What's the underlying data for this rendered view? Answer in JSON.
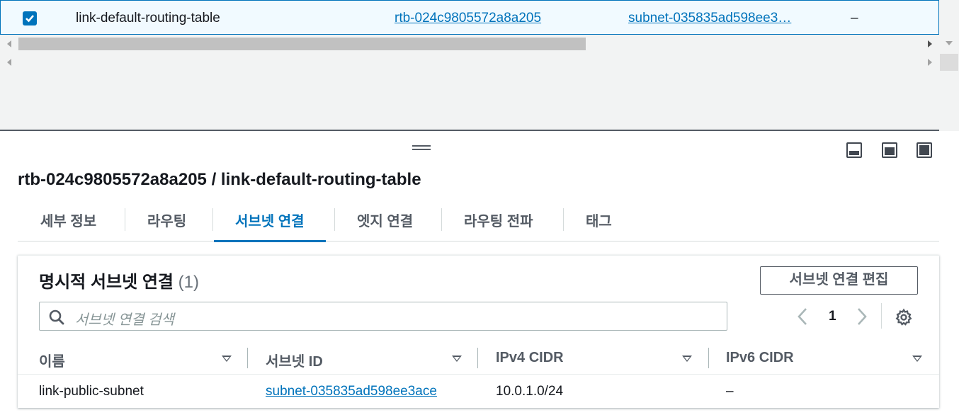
{
  "top_table": {
    "row": {
      "name": "link-default-routing-table",
      "route_table_id": "rtb-024c9805572a8a205",
      "subnet": "subnet-035835ad598ee3…",
      "extra": "–"
    }
  },
  "detail": {
    "title": "rtb-024c9805572a8a205 / link-default-routing-table",
    "tabs": [
      {
        "label": "세부 정보"
      },
      {
        "label": "라우팅"
      },
      {
        "label": "서브넷 연결"
      },
      {
        "label": "엣지 연결"
      },
      {
        "label": "라우팅 전파"
      },
      {
        "label": "태그"
      }
    ],
    "active_tab": "서브넷 연결"
  },
  "subnet_assoc": {
    "title": "명시적 서브넷 연결",
    "count": "(1)",
    "edit_button": "서브넷 연결 편집",
    "search_placeholder": "서브넷 연결 검색",
    "page": "1",
    "columns": [
      "이름",
      "서브넷 ID",
      "IPv4 CIDR",
      "IPv6 CIDR"
    ],
    "rows": [
      {
        "name": "link-public-subnet",
        "subnet_id": "subnet-035835ad598ee3ace",
        "ipv4": "10.0.1.0/24",
        "ipv6": "–"
      }
    ]
  },
  "colors": {
    "accent": "#0073bb",
    "text": "#16191f",
    "muted": "#545b64",
    "border": "#aab7b8"
  }
}
